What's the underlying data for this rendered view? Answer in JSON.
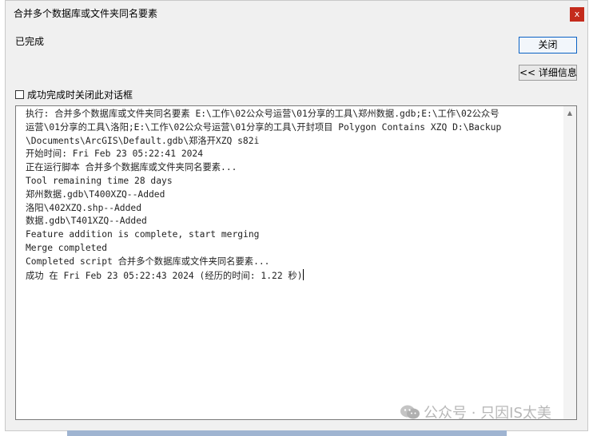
{
  "window": {
    "title": "合并多个数据库或文件夹同名要素",
    "close_glyph": "x"
  },
  "status_text": "已完成",
  "buttons": {
    "close_label": "关闭",
    "details_label": "<< 详细信息"
  },
  "checkbox": {
    "label": "成功完成时关闭此对话框",
    "checked": false
  },
  "log": [
    "执行: 合并多个数据库或文件夹同名要素 E:\\工作\\02公众号运营\\01分享的工具\\郑州数据.gdb;E:\\工作\\02公众号",
    "运营\\01分享的工具\\洛阳;E:\\工作\\02公众号运营\\01分享的工具\\开封项目 Polygon Contains XZQ D:\\Backup",
    "\\Documents\\ArcGIS\\Default.gdb\\郑洛开XZQ s82i",
    "开始时间: Fri Feb 23 05:22:41 2024",
    "正在运行脚本 合并多个数据库或文件夹同名要素...",
    "Tool remaining time  28  days",
    "郑州数据.gdb\\T400XZQ--Added",
    "洛阳\\402XZQ.shp--Added",
    "数据.gdb\\T401XZQ--Added",
    "Feature addition is complete, start merging",
    "Merge completed",
    "Completed script 合并多个数据库或文件夹同名要素...",
    "成功 在 Fri Feb 23 05:22:43 2024 (经历的时间: 1.22 秒)"
  ],
  "watermark": "公众号 · 只因IS太美",
  "colors": {
    "close_red": "#c42b1c",
    "primary_border": "#0b62c4",
    "dialog_bg": "#f0f0f0"
  }
}
